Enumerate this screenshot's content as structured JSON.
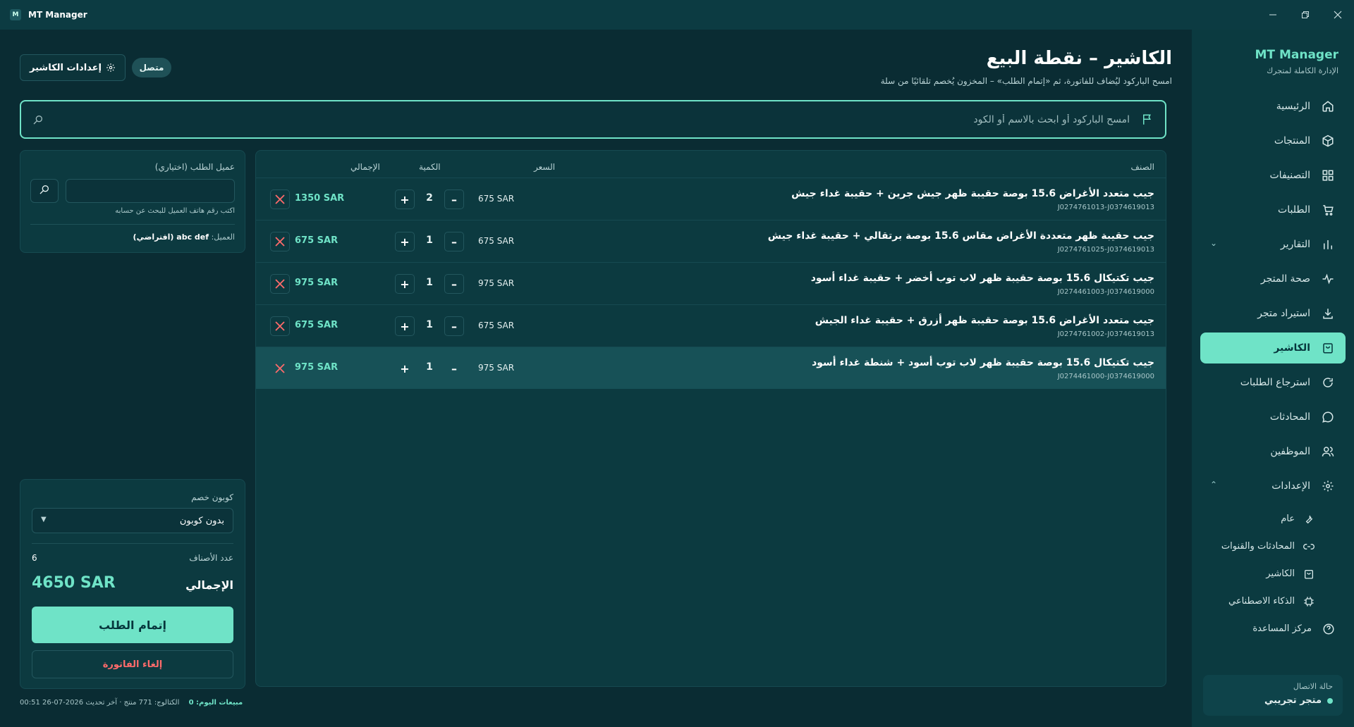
{
  "window": {
    "title": "MT Manager",
    "logo_letter": "M"
  },
  "sidebar": {
    "brand": "MT Manager",
    "brand_sub": "الإدارة الكاملة لمتجرك",
    "items": [
      {
        "label": "الرئيسية",
        "icon": "home-icon"
      },
      {
        "label": "المنتجات",
        "icon": "box-icon"
      },
      {
        "label": "التصنيفات",
        "icon": "grid-icon"
      },
      {
        "label": "الطلبات",
        "icon": "cart-icon"
      },
      {
        "label": "التقارير",
        "icon": "bar-chart-icon"
      },
      {
        "label": "صحة المتجر",
        "icon": "pulse-icon"
      },
      {
        "label": "استيراد متجر",
        "icon": "download-icon"
      },
      {
        "label": "الكاشير",
        "icon": "bag-icon"
      },
      {
        "label": "استرجاع الطلبات",
        "icon": "refresh-icon"
      },
      {
        "label": "المحادثات",
        "icon": "chat-icon"
      },
      {
        "label": "الموظفين",
        "icon": "users-icon"
      },
      {
        "label": "الإعدادات",
        "icon": "gear-icon"
      }
    ],
    "sub_items": [
      {
        "label": "عام",
        "icon": "wrench-icon"
      },
      {
        "label": "المحادثات والقنوات",
        "icon": "link-icon"
      },
      {
        "label": "الكاشير",
        "icon": "bag-icon"
      },
      {
        "label": "الذكاء الاصطناعي",
        "icon": "chip-icon"
      },
      {
        "label": "مركز المساعدة",
        "icon": "help-icon"
      }
    ],
    "connection": {
      "label": "حالة الاتصال",
      "store": "متجر تجريبي"
    }
  },
  "header": {
    "title": "الكاشير – نقطة البيع",
    "subtitle": "امسح الباركود ليُضاف للفاتورة، ثم «إتمام الطلب» – المخزون يُخصم تلقائيًا من سلة",
    "settings_button": "إعدادات الكاشير",
    "status": "متصل"
  },
  "search": {
    "placeholder": "امسح الباركود أو ابحث بالاسم أو الكود"
  },
  "cart": {
    "columns": {
      "item": "الصنف",
      "price": "السعر",
      "qty": "الكمية",
      "total": "الإجمالي"
    },
    "rows": [
      {
        "name": "جيب متعدد الأغراض 15.6 بوصة حقيبة ظهر جيش جرين + حقيبة غداء جيش",
        "sku": "J0274761013-J0374619013",
        "price": "675 SAR",
        "qty": "2",
        "total": "1350 SAR"
      },
      {
        "name": "جيب حقيبة ظهر متعددة الأغراض مقاس 15.6 بوصة برتقالي + حقيبة غداء جيش",
        "sku": "J0274761025-J0374619013",
        "price": "675 SAR",
        "qty": "1",
        "total": "675 SAR"
      },
      {
        "name": "جيب تكتيكال 15.6 بوصة حقيبة ظهر لاب توب أخضر + حقيبة غداء أسود",
        "sku": "J0274461003-J0374619000",
        "price": "975 SAR",
        "qty": "1",
        "total": "975 SAR"
      },
      {
        "name": "جيب متعدد الأغراض 15.6 بوصة حقيبة ظهر أزرق + حقيبة غداء الجيش",
        "sku": "J0274761002-J0374619013",
        "price": "675 SAR",
        "qty": "1",
        "total": "675 SAR"
      },
      {
        "name": "جيب تكتيكال 15.6 بوصة حقيبة ظهر لاب توب أسود + شنطة غداء أسود",
        "sku": "J0274461000-J0374619000",
        "price": "975 SAR",
        "qty": "1",
        "total": "975 SAR"
      }
    ],
    "plus": "+",
    "minus": "–"
  },
  "customer": {
    "title": "عميل الطلب (اختياري)",
    "hint": "اكتب رقم هاتف العميل للبحث عن حسابه",
    "label": "العميل:",
    "value": "abc def (افتراضي)"
  },
  "totals": {
    "coupon_label": "كوبون خصم",
    "coupon_value": "بدون كوبون",
    "items_label": "عدد الأصناف",
    "items_count": "6",
    "grand_label": "الإجمالي",
    "grand_value": "4650 SAR",
    "checkout": "إتمام الطلب",
    "cancel": "إلغاء الفاتورة"
  },
  "footer": {
    "today": "مبيعات اليوم: 0",
    "info": "الكتالوج: 771 منتج · آخر تحديث 2026-07-26 00:51"
  },
  "colors": {
    "accent": "#6fe3c7",
    "danger": "#ff6b6b",
    "bg": "#0a2c33",
    "sidebar": "#0b3a40"
  }
}
